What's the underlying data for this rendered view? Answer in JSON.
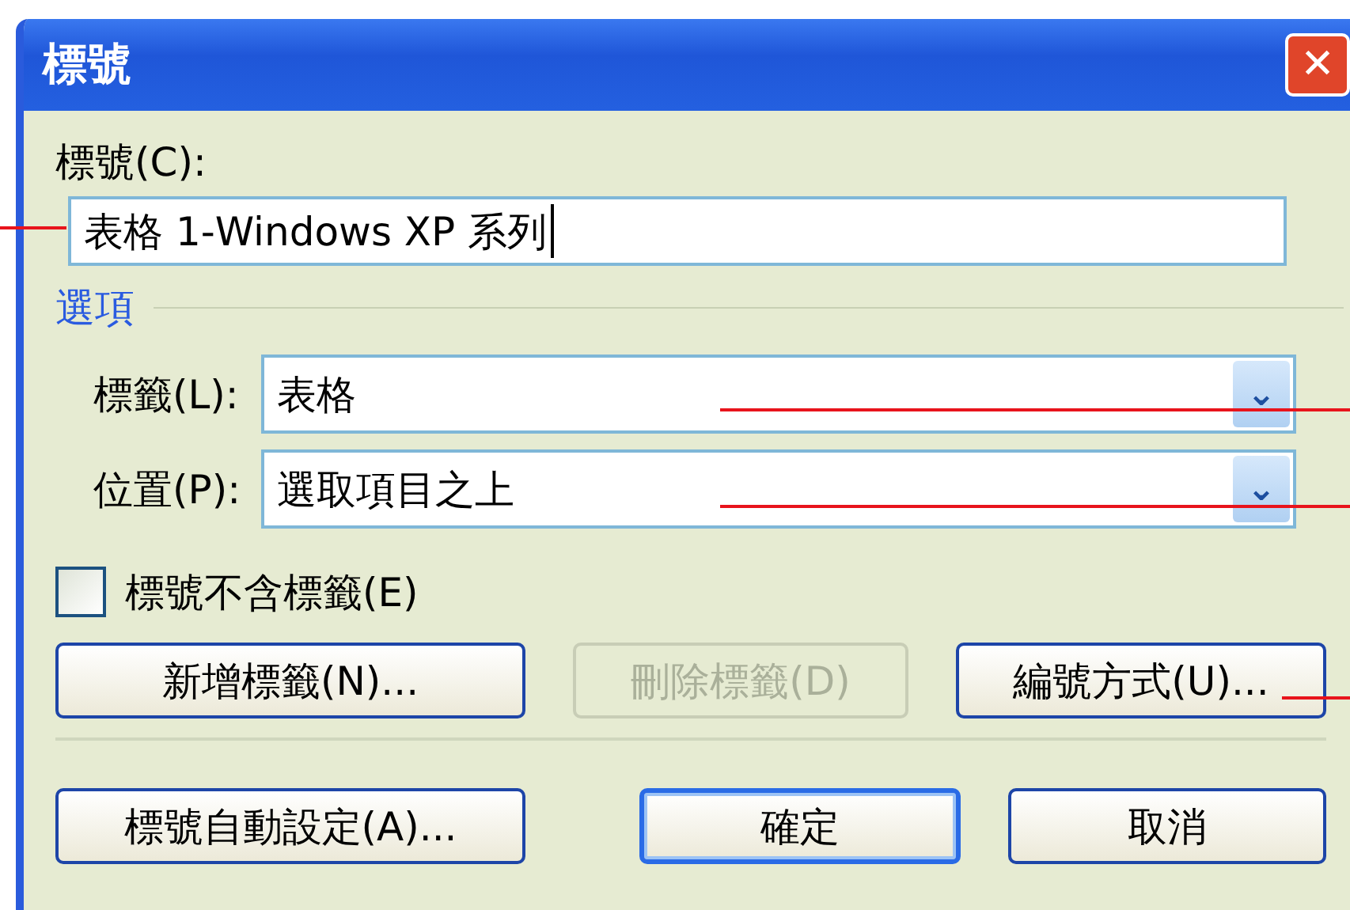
{
  "window": {
    "title": "標號",
    "close": "✕"
  },
  "caption": {
    "label": "標號(C):",
    "value": "表格  1-Windows XP 系列"
  },
  "options": {
    "heading": "選項",
    "fields": [
      {
        "label": "標籤(L):",
        "value": "表格",
        "arrow": "⌄"
      },
      {
        "label": "位置(P):",
        "value": "選取項目之上",
        "arrow": "⌄"
      }
    ]
  },
  "exclude_label": {
    "label": "標號不含標籤(E)",
    "checked": false
  },
  "label_buttons": [
    {
      "label": "新增標籤(N)...",
      "disabled": false,
      "default": false
    },
    {
      "label": "刪除標籤(D)",
      "disabled": true,
      "default": false
    },
    {
      "label": "編號方式(U)...",
      "disabled": false,
      "default": false
    }
  ],
  "footer_buttons": [
    {
      "label": "標號自動設定(A)...",
      "disabled": false,
      "default": false
    },
    {
      "label": "確定",
      "disabled": false,
      "default": true
    },
    {
      "label": "取消",
      "disabled": false,
      "default": false
    }
  ]
}
